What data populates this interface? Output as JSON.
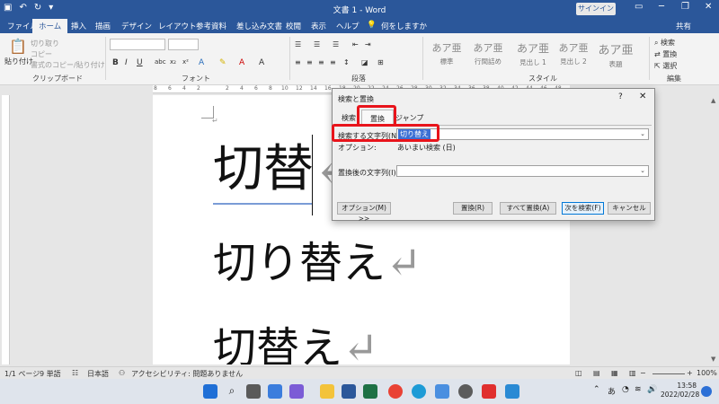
{
  "window": {
    "title": "文書 1 - Word",
    "signin": "サインイン"
  },
  "tabs": [
    "ファイル",
    "ホーム",
    "挿入",
    "描画",
    "デザイン",
    "レイアウト",
    "参考資料",
    "差し込み文書",
    "校閲",
    "表示",
    "ヘルプ"
  ],
  "tell_me": "何をしますか",
  "share": "共有",
  "ribbon": {
    "clipboard": {
      "paste": "貼り付け",
      "cut": "切り取り",
      "copy": "コピー",
      "format_painter": "書式のコピー/貼り付け",
      "label": "クリップボード"
    },
    "font": {
      "label": "フォント"
    },
    "paragraph": {
      "label": "段落"
    },
    "styles": {
      "label": "スタイル",
      "items": [
        {
          "sample": "あア亜",
          "name": "標準"
        },
        {
          "sample": "あア亜",
          "name": "行間詰め"
        },
        {
          "sample": "あア亜",
          "name": "見出し 1"
        },
        {
          "sample": "あア亜",
          "name": "見出し 2"
        },
        {
          "sample": "あア亜",
          "name": "表題"
        }
      ]
    },
    "editing": {
      "label": "編集",
      "find": "検索",
      "replace": "置換",
      "select": "選択"
    }
  },
  "ruler_numbers": [
    "8",
    "6",
    "4",
    "2",
    "",
    "2",
    "4",
    "6",
    "8",
    "10",
    "12",
    "14",
    "16",
    "18",
    "20",
    "22",
    "24",
    "26",
    "28",
    "30",
    "32",
    "34",
    "36",
    "38",
    "40",
    "42",
    "44",
    "46",
    "48"
  ],
  "document": {
    "paragraph_mark": "↵",
    "line1": "切替",
    "line2": "切り替え",
    "line3": "切替え"
  },
  "dialog": {
    "title": "検索と置換",
    "help": "?",
    "close": "✕",
    "tabs": {
      "find": "検索",
      "replace": "置換",
      "goto": "ジャンプ"
    },
    "find_label": "検索する文字列(N):",
    "find_value": "切り替え",
    "options_label": "オプション:",
    "options_value": "あいまい検索 (日)",
    "replace_label": "置換後の文字列(I):",
    "replace_value": "",
    "buttons": {
      "options": "オプション(M) >>",
      "replace": "置換(R)",
      "replace_all": "すべて置換(A)",
      "find_next": "次を検索(F)",
      "cancel": "キャンセル"
    }
  },
  "status": {
    "page": "1/1 ページ",
    "words": "9 単語",
    "language": "日本語",
    "accessibility": "アクセシビリティ: 問題ありません",
    "zoom": "100%"
  },
  "taskbar": {
    "time": "13:58",
    "date": "2022/02/28",
    "ime": "あ"
  },
  "colors": {
    "word_blue": "#2b579a",
    "highlight_red": "#e8141b"
  }
}
